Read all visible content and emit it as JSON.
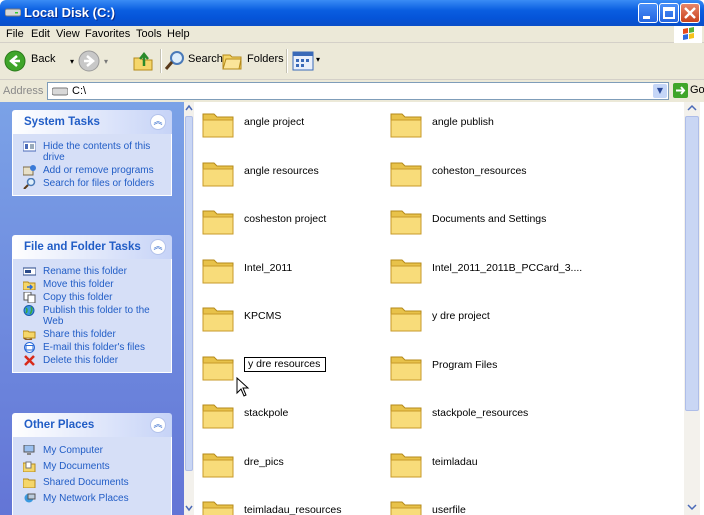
{
  "window": {
    "title": "Local Disk (C:)"
  },
  "menu": [
    "File",
    "Edit",
    "View",
    "Favorites",
    "Tools",
    "Help"
  ],
  "toolbar": {
    "back": "Back",
    "search": "Search",
    "folders": "Folders"
  },
  "address": {
    "label": "Address",
    "value": "C:\\",
    "go": "Go"
  },
  "left_pane": {
    "system_tasks": {
      "title": "System Tasks",
      "items": [
        "Hide the contents of this drive",
        "Add or remove programs",
        "Search for files or folders"
      ]
    },
    "file_folder_tasks": {
      "title": "File and Folder Tasks",
      "items": [
        "Rename this folder",
        "Move this folder",
        "Copy this folder",
        "Publish this folder to the Web",
        "Share this folder",
        "E-mail this folder's files",
        "Delete this folder"
      ]
    },
    "other_places": {
      "title": "Other Places",
      "items": [
        "My Computer",
        "My Documents",
        "Shared Documents",
        "My Network Places"
      ]
    }
  },
  "folders": [
    "angle project",
    "angle publish",
    "angle resources",
    "coheston_resources",
    "cosheston project",
    "Documents and Settings",
    "Intel_2011",
    "Intel_2011_2011B_PCCard_3....",
    "KPCMS",
    "y dre project",
    "y dre resources",
    "Program Files",
    "stackpole",
    "stackpole_resources",
    "dre_pics",
    "teimladau",
    "teimladau_resources",
    "userfile"
  ],
  "rename_index": 10,
  "colors": {
    "titlebar": "#0a5ee0",
    "task_link": "#215dc6",
    "left_pane": "#7ba2e7",
    "folder": "#f5d66a"
  }
}
